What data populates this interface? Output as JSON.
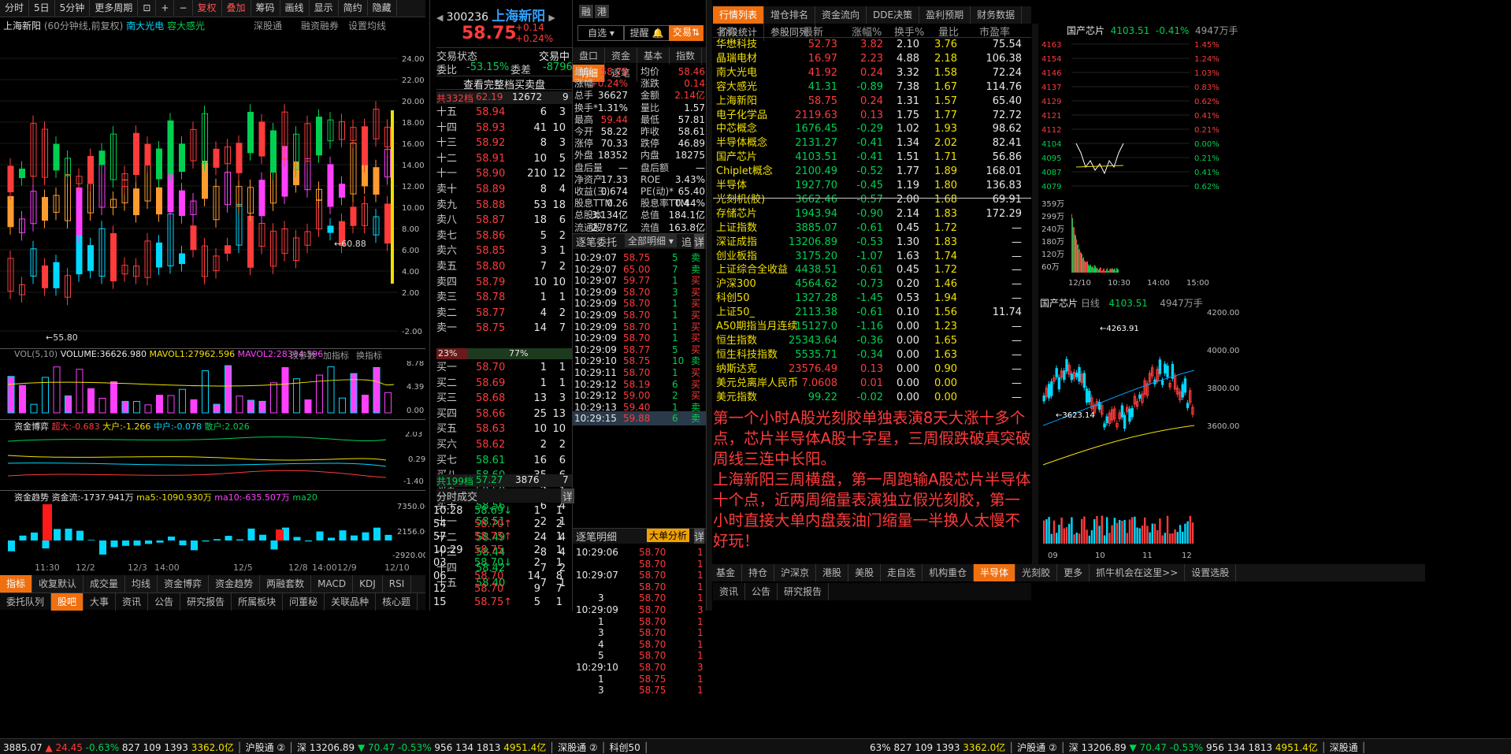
{
  "toolbar": [
    "分时",
    "5日",
    "5分钟",
    "更多周期",
    "复权",
    "叠加",
    "筹码",
    "画线",
    "显示",
    "简约",
    "隐藏"
  ],
  "chart_header": {
    "name": "上海新阳",
    "period": "(60分钟线,前复权)",
    "overlay1": "南大光电",
    "overlay2": "容大感光",
    "r1": "深股通",
    "r2": "融资融券",
    "r3": "设置均线"
  },
  "y_ticks": [
    "24.00",
    "22.00",
    "20.00",
    "18.00",
    "16.00",
    "14.00",
    "12.00",
    "10.00",
    "8.00",
    "6.00",
    "4.00",
    "2.00",
    "-2.00"
  ],
  "kline_marks": {
    "low": "55.80",
    "mid": "60.88"
  },
  "vol": {
    "label": "VOL(5,10)",
    "v": "VOLUME:36626.980",
    "m1": "MAVOL1:27962.596",
    "m2": "MAVOL2:28334.596",
    "a1": "改参数",
    "a2": "加指标",
    "a3": "换指标",
    "t1": "8.78",
    "t2": "4.39",
    "t3": "0.00"
  },
  "game": {
    "label": "资金博弈",
    "a": "超大:-0.683",
    "b": "大户:-1.266",
    "c": "中户:-0.078",
    "d": "散户:2.026",
    "t1": "2.03",
    "t2": "0.29",
    "t3": "-1.40"
  },
  "trend": {
    "label": "资金趋势",
    "a": "资金流:-1737.941万",
    "b": "ma5:-1090.930万",
    "c": "ma10:-635.507万",
    "d": "ma20",
    "t1": "7350.00",
    "t2": "2156.00",
    "t3": "-2920.00"
  },
  "x_labels": [
    "11:30",
    "12/2",
    "12/3",
    "14:00",
    "12/5",
    "12/8",
    "14:00",
    "12/9",
    "12/10"
  ],
  "ind_tabs": [
    "指标",
    "收复默认",
    "成交量",
    "均线",
    "资金博弈",
    "资金趋势",
    "两融套数",
    "MACD",
    "KDJ",
    "RSI",
    "更多",
    "模板"
  ],
  "bottom_tabs": [
    "委托队列",
    "股吧",
    "大事",
    "资讯",
    "公告",
    "研究报告",
    "所属板块",
    "问董秘",
    "关联品种",
    "核心题"
  ],
  "quote": {
    "code": "300236",
    "name": "上海新阳",
    "b1": "融",
    "b2": "港",
    "price": "58.75",
    "chg": "+0.14",
    "pct": "+0.24%",
    "sel": "自选",
    "warn": "提醒",
    "trade": "交易"
  },
  "order_hdr": {
    "a": "交易状态",
    "b": "交易中",
    "c": "委比",
    "d": "-53.15%",
    "e": "委差",
    "f": "-8796",
    "g": "查看完整档买卖盘",
    "h": "共332档",
    "i": "62.19",
    "j": "12672",
    "k": "9"
  },
  "asks": [
    [
      "十五",
      "58.94",
      "6",
      "3"
    ],
    [
      "十四",
      "58.93",
      "41",
      "10"
    ],
    [
      "十三",
      "58.92",
      "8",
      "3"
    ],
    [
      "十二",
      "58.91",
      "10",
      "5"
    ],
    [
      "十一",
      "58.90",
      "210",
      "12"
    ],
    [
      "卖十",
      "58.89",
      "8",
      "4"
    ],
    [
      "卖九",
      "58.88",
      "53",
      "18"
    ],
    [
      "卖八",
      "58.87",
      "18",
      "6"
    ],
    [
      "卖七",
      "58.86",
      "5",
      "2"
    ],
    [
      "卖六",
      "58.85",
      "3",
      "1"
    ],
    [
      "卖五",
      "58.80",
      "7",
      "2"
    ],
    [
      "卖四",
      "58.79",
      "10",
      "10"
    ],
    [
      "卖三",
      "58.78",
      "1",
      "1"
    ],
    [
      "卖二",
      "58.77",
      "4",
      "2"
    ],
    [
      "卖一",
      "58.75",
      "14",
      "7"
    ]
  ],
  "ratio": {
    "a": "23%",
    "b": "77%"
  },
  "bids": [
    [
      "买一",
      "58.70",
      "1",
      "1"
    ],
    [
      "买二",
      "58.69",
      "1",
      "1"
    ],
    [
      "买三",
      "58.68",
      "13",
      "3"
    ],
    [
      "买四",
      "58.66",
      "25",
      "13"
    ],
    [
      "买五",
      "58.63",
      "10",
      "10"
    ],
    [
      "买六",
      "58.62",
      "2",
      "2"
    ],
    [
      "买七",
      "58.61",
      "16",
      "6"
    ],
    [
      "买八",
      "58.60",
      "35",
      "6"
    ],
    [
      "买九",
      "58.58",
      "2",
      "1"
    ],
    [
      "买十",
      "58.56",
      "6",
      "4"
    ],
    [
      "十一",
      "58.51",
      "2",
      "1"
    ],
    [
      "十二",
      "58.49",
      "4",
      "4"
    ],
    [
      "十三",
      "58.44",
      "8",
      "4"
    ],
    [
      "十四",
      "58.42",
      "7",
      "2"
    ],
    [
      "十五",
      "58.40",
      "7",
      "1"
    ]
  ],
  "bid_total": {
    "a": "共199档",
    "b": "57.27",
    "c": "3876",
    "d": "7"
  },
  "ticks_hdr": {
    "a": "分时成交",
    "b": "详"
  },
  "ticks": [
    [
      "10:28",
      "58.69",
      "1",
      "1",
      "g"
    ],
    [
      "54",
      "58.70",
      "2",
      "2",
      "r"
    ],
    [
      "57",
      "58.75",
      "2",
      "1",
      "r"
    ],
    [
      "10:29",
      "58.75",
      "2",
      "1",
      "w"
    ],
    [
      "03",
      "58.70",
      "2",
      "1",
      "g"
    ],
    [
      "06",
      "58.70",
      "14",
      "8",
      "w"
    ],
    [
      "12",
      "58.70",
      "9",
      "7",
      "w"
    ],
    [
      "15",
      "58.75",
      "5",
      "1",
      "r"
    ]
  ],
  "stat_tabs": [
    "盘口",
    "资金",
    "基本",
    "指数",
    "明细",
    "逐笔"
  ],
  "stats": [
    [
      "最新",
      "58.75",
      "均价",
      "58.46"
    ],
    [
      "涨幅",
      "+0.24%",
      "涨跌",
      "0.14"
    ],
    [
      "总手",
      "36627",
      "金额",
      "2.14亿"
    ],
    [
      "换手*",
      "1.31%",
      "量比",
      "1.57"
    ],
    [
      "最高",
      "59.44",
      "最低",
      "57.81"
    ],
    [
      "今开",
      "58.22",
      "昨收",
      "58.61"
    ],
    [
      "涨停",
      "70.33",
      "跌停",
      "46.89"
    ],
    [
      "外盘",
      "18352",
      "内盘",
      "18275"
    ],
    [
      "盘后量",
      "—",
      "盘后额",
      "—"
    ],
    [
      "净资产",
      "17.33",
      "ROE",
      "3.43%"
    ],
    [
      "收益(三)",
      "0.674",
      "PE(动)*",
      "65.40"
    ],
    [
      "股息TTM",
      "0.26",
      "股息率TTM",
      "0.44%"
    ],
    [
      "总股本",
      "3.134亿",
      "总值",
      "184.1亿"
    ],
    [
      "流通股",
      "2.787亿",
      "流值",
      "163.8亿"
    ]
  ],
  "zb_hdr": {
    "a": "逐笔委托",
    "b": "全部明细",
    "c": "追",
    "d": "详"
  },
  "zb": [
    [
      "10:29:07",
      "58.75",
      "5",
      "卖"
    ],
    [
      "10:29:07",
      "65.00",
      "7",
      "卖"
    ],
    [
      "10:29:07",
      "59.77",
      "1",
      "买"
    ],
    [
      "10:29:09",
      "58.70",
      "3",
      "买"
    ],
    [
      "10:29:09",
      "58.70",
      "1",
      "买"
    ],
    [
      "10:29:09",
      "58.70",
      "1",
      "买"
    ],
    [
      "10:29:09",
      "58.70",
      "1",
      "买"
    ],
    [
      "10:29:09",
      "58.70",
      "1",
      "买"
    ],
    [
      "10:29:09",
      "58.77",
      "5",
      "买"
    ],
    [
      "10:29:10",
      "58.75",
      "10",
      "卖"
    ],
    [
      "10:29:11",
      "58.70",
      "1",
      "买"
    ],
    [
      "10:29:12",
      "58.19",
      "6",
      "买"
    ],
    [
      "10:29:12",
      "59.00",
      "2",
      "买"
    ],
    [
      "10:29:13",
      "59.40",
      "1",
      "卖"
    ],
    [
      "10:29:15",
      "59.88",
      "6",
      "卖"
    ]
  ],
  "mx_hdr": {
    "a": "逐笔明细",
    "b": "大单分析",
    "c": "详"
  },
  "mx": [
    [
      "10:29:06",
      "58.70",
      "1"
    ],
    [
      "",
      "58.70",
      "1"
    ],
    [
      "10:29:07",
      "58.70",
      "1"
    ],
    [
      "",
      "58.70",
      "1"
    ],
    [
      "3",
      "58.70",
      "1"
    ],
    [
      "10:29:09",
      "58.70",
      "3"
    ],
    [
      "1",
      "58.70",
      "1"
    ],
    [
      "3",
      "58.70",
      "1"
    ],
    [
      "4",
      "58.70",
      "1"
    ],
    [
      "5",
      "58.70",
      "1"
    ],
    [
      "10:29:10",
      "58.70",
      "3"
    ],
    [
      "1",
      "58.75",
      "1"
    ],
    [
      "3",
      "58.75",
      "1"
    ]
  ],
  "list_tabs": [
    "行情列表",
    "增仓排名",
    "资金流向",
    "DDE决策",
    "盈利预期",
    "财务数据",
    "阶段统计",
    "参股同列"
  ],
  "list_cols": [
    "名称",
    "最新",
    "涨幅%",
    "换手%",
    "量比",
    "市盈率"
  ],
  "list": [
    [
      "华懋科技",
      "52.73",
      "3.82",
      "2.10",
      "3.76",
      "75.54"
    ],
    [
      "晶瑞电材",
      "16.97",
      "2.23",
      "4.88",
      "2.18",
      "106.38"
    ],
    [
      "南大光电",
      "41.92",
      "0.24",
      "3.32",
      "1.58",
      "72.24"
    ],
    [
      "容大感光",
      "41.31",
      "-0.89",
      "7.38",
      "1.67",
      "114.76"
    ],
    [
      "上海新阳",
      "58.75",
      "0.24",
      "1.31",
      "1.57",
      "65.40"
    ],
    [
      "电子化学品",
      "2119.63",
      "0.13",
      "1.75",
      "1.77",
      "72.72"
    ],
    [
      "中芯概念",
      "1676.45",
      "-0.29",
      "1.02",
      "1.93",
      "98.62"
    ],
    [
      "半导体概念",
      "2131.27",
      "-0.41",
      "1.34",
      "2.02",
      "82.41"
    ],
    [
      "国产芯片",
      "4103.51",
      "-0.41",
      "1.51",
      "1.71",
      "56.86"
    ],
    [
      "Chiplet概念",
      "2100.49",
      "-0.52",
      "1.77",
      "1.89",
      "168.01"
    ],
    [
      "半导体",
      "1927.70",
      "-0.45",
      "1.19",
      "1.80",
      "136.83"
    ],
    [
      "光刻机(胶)",
      "3662.46",
      "-0.57",
      "2.00",
      "1.68",
      "69.91"
    ],
    [
      "存储芯片",
      "1943.94",
      "-0.90",
      "2.14",
      "1.83",
      "172.29"
    ],
    [
      "上证指数",
      "3885.07",
      "-0.61",
      "0.45",
      "1.72",
      "—"
    ],
    [
      "深证成指",
      "13206.89",
      "-0.53",
      "1.30",
      "1.83",
      "—"
    ],
    [
      "创业板指",
      "3175.20",
      "-1.07",
      "1.63",
      "1.74",
      "—"
    ],
    [
      "上证综合全收益",
      "4438.51",
      "-0.61",
      "0.45",
      "1.72",
      "—"
    ],
    [
      "沪深300",
      "4564.62",
      "-0.73",
      "0.20",
      "1.46",
      "—"
    ],
    [
      "科创50",
      "1327.28",
      "-1.45",
      "0.53",
      "1.94",
      "—"
    ],
    [
      "上证50_",
      "2113.38",
      "-0.61",
      "0.10",
      "1.56",
      "11.74"
    ],
    [
      "A50期指当月连续",
      "15127.0",
      "-1.16",
      "0.00",
      "1.23",
      "—"
    ],
    [
      "恒生指数",
      "25343.64",
      "-0.36",
      "0.00",
      "1.65",
      "—"
    ],
    [
      "恒生科技指数",
      "5535.71",
      "-0.34",
      "0.00",
      "1.63",
      "—"
    ],
    [
      "纳斯达克",
      "23576.49",
      "0.13",
      "0.00",
      "0.90",
      "—"
    ],
    [
      "美元兑离岸人民币",
      "7.0608",
      "0.01",
      "0.00",
      "0.00",
      "—"
    ],
    [
      "美元指数",
      "99.22",
      "-0.02",
      "0.00",
      "0.00",
      "—"
    ]
  ],
  "note": "第一个小时A股光刻胶单独表演8天大涨十多个点，芯片半导体A股十字星，三周假跌破真突破周线三连中长阳。\n上海新阳三周横盘，第一周跑输A股芯片半导体十个点，近两周缩量表演独立假光刻胶，第一小时直接大单内盘轰油门缩量一半换人太慢不好玩！",
  "sector_tabs": [
    "基金",
    "持仓",
    "沪深京",
    "港股",
    "美股",
    "走自选",
    "机构重仓",
    "半导体",
    "光刻胶",
    "更多",
    "抓牛机会在这里>>",
    "设置选股"
  ],
  "mini": {
    "name": "国产芯片",
    "price": "4103.51",
    "pct": "-0.41%",
    "vol": "4947万手",
    "y": [
      "4163",
      "4154",
      "4146",
      "4137",
      "4129",
      "4121",
      "4112",
      "4104",
      "4095",
      "4087",
      "4079"
    ],
    "p": [
      "1.45%",
      "1.24%",
      "1.03%",
      "0.83%",
      "0.62%",
      "0.41%",
      "0.21%",
      "0.00%",
      "0.21%",
      "0.41%",
      "0.62%"
    ],
    "v": [
      "359万",
      "299万",
      "240万",
      "180万",
      "120万",
      "60万"
    ],
    "x": [
      "12/10",
      "10:30",
      "14:00",
      "15:00"
    ]
  },
  "daily": {
    "name": "国产芯片",
    "k": "日线",
    "price": "4103.51",
    "vol": "4947万手",
    "hi": "4263.91",
    "lo": "3623.14",
    "y": [
      "4200.00",
      "4000.00",
      "3800.00",
      "3600.00"
    ],
    "x": [
      "09",
      "10",
      "11",
      "12"
    ]
  },
  "panel_tabs": [
    "资讯",
    "公告",
    "研究报告"
  ],
  "status": [
    [
      "3885.07",
      "▲ 24.45",
      "-0.63%",
      "827",
      "109",
      "1393",
      "3362.0亿"
    ],
    [
      "沪股通",
      "②"
    ],
    [
      "深",
      "13206.89",
      "▼ 70.47",
      "-0.53%",
      "956",
      "134",
      "1813",
      "4951.4亿"
    ],
    [
      "深股通",
      "②"
    ],
    [
      "科创50"
    ]
  ],
  "status_r": [
    [
      "63%",
      "827",
      "109",
      "1393",
      "3362.0亿"
    ],
    [
      "沪股通",
      "②"
    ],
    [
      "深",
      "13206.89",
      "▼ 70.47",
      "-0.53%",
      "956",
      "134",
      "1813",
      "4951.4亿"
    ],
    [
      "深股通"
    ]
  ],
  "colors": {
    "up": "#ff3b3b",
    "down": "#00d050",
    "accent": "#f07010"
  }
}
